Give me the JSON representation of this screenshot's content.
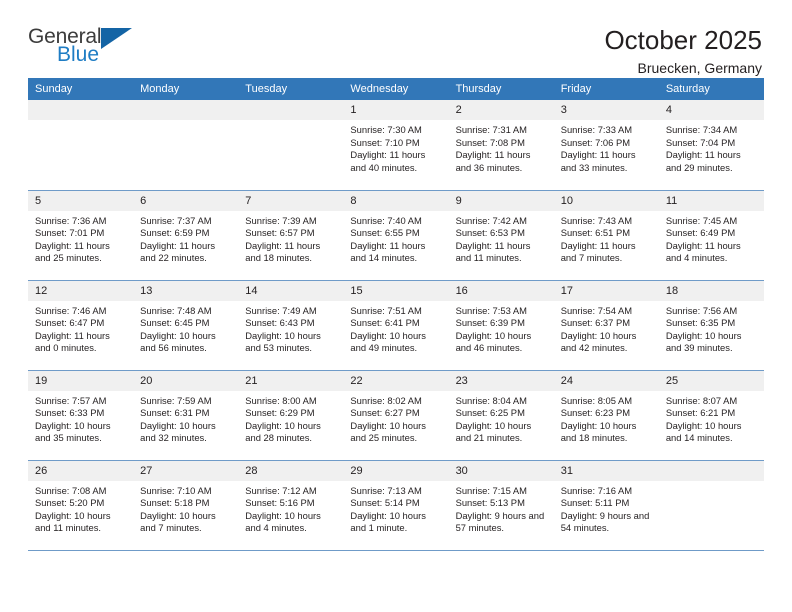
{
  "brand": {
    "name_top": "General",
    "name_bottom": "Blue",
    "triangle_color": "#1464a5",
    "blue_color": "#1f7dc4"
  },
  "header": {
    "title": "October 2025",
    "subtitle": "Bruecken, Germany"
  },
  "theme": {
    "header_bg": "#3277b8",
    "header_text": "#ffffff",
    "daynum_bg": "#f0f0f0",
    "row_border": "#6f9bc8"
  },
  "weekdays": [
    "Sunday",
    "Monday",
    "Tuesday",
    "Wednesday",
    "Thursday",
    "Friday",
    "Saturday"
  ],
  "labels": {
    "sunrise_prefix": "Sunrise: ",
    "sunset_prefix": "Sunset: ",
    "daylight_prefix": "Daylight: "
  },
  "weeks": [
    [
      {
        "day": "",
        "empty": true
      },
      {
        "day": "",
        "empty": true
      },
      {
        "day": "",
        "empty": true
      },
      {
        "day": "1",
        "sunrise": "Sunrise: 7:30 AM",
        "sunset": "Sunset: 7:10 PM",
        "daylight": "Daylight: 11 hours and 40 minutes."
      },
      {
        "day": "2",
        "sunrise": "Sunrise: 7:31 AM",
        "sunset": "Sunset: 7:08 PM",
        "daylight": "Daylight: 11 hours and 36 minutes."
      },
      {
        "day": "3",
        "sunrise": "Sunrise: 7:33 AM",
        "sunset": "Sunset: 7:06 PM",
        "daylight": "Daylight: 11 hours and 33 minutes."
      },
      {
        "day": "4",
        "sunrise": "Sunrise: 7:34 AM",
        "sunset": "Sunset: 7:04 PM",
        "daylight": "Daylight: 11 hours and 29 minutes."
      }
    ],
    [
      {
        "day": "5",
        "sunrise": "Sunrise: 7:36 AM",
        "sunset": "Sunset: 7:01 PM",
        "daylight": "Daylight: 11 hours and 25 minutes."
      },
      {
        "day": "6",
        "sunrise": "Sunrise: 7:37 AM",
        "sunset": "Sunset: 6:59 PM",
        "daylight": "Daylight: 11 hours and 22 minutes."
      },
      {
        "day": "7",
        "sunrise": "Sunrise: 7:39 AM",
        "sunset": "Sunset: 6:57 PM",
        "daylight": "Daylight: 11 hours and 18 minutes."
      },
      {
        "day": "8",
        "sunrise": "Sunrise: 7:40 AM",
        "sunset": "Sunset: 6:55 PM",
        "daylight": "Daylight: 11 hours and 14 minutes."
      },
      {
        "day": "9",
        "sunrise": "Sunrise: 7:42 AM",
        "sunset": "Sunset: 6:53 PM",
        "daylight": "Daylight: 11 hours and 11 minutes."
      },
      {
        "day": "10",
        "sunrise": "Sunrise: 7:43 AM",
        "sunset": "Sunset: 6:51 PM",
        "daylight": "Daylight: 11 hours and 7 minutes."
      },
      {
        "day": "11",
        "sunrise": "Sunrise: 7:45 AM",
        "sunset": "Sunset: 6:49 PM",
        "daylight": "Daylight: 11 hours and 4 minutes."
      }
    ],
    [
      {
        "day": "12",
        "sunrise": "Sunrise: 7:46 AM",
        "sunset": "Sunset: 6:47 PM",
        "daylight": "Daylight: 11 hours and 0 minutes."
      },
      {
        "day": "13",
        "sunrise": "Sunrise: 7:48 AM",
        "sunset": "Sunset: 6:45 PM",
        "daylight": "Daylight: 10 hours and 56 minutes."
      },
      {
        "day": "14",
        "sunrise": "Sunrise: 7:49 AM",
        "sunset": "Sunset: 6:43 PM",
        "daylight": "Daylight: 10 hours and 53 minutes."
      },
      {
        "day": "15",
        "sunrise": "Sunrise: 7:51 AM",
        "sunset": "Sunset: 6:41 PM",
        "daylight": "Daylight: 10 hours and 49 minutes."
      },
      {
        "day": "16",
        "sunrise": "Sunrise: 7:53 AM",
        "sunset": "Sunset: 6:39 PM",
        "daylight": "Daylight: 10 hours and 46 minutes."
      },
      {
        "day": "17",
        "sunrise": "Sunrise: 7:54 AM",
        "sunset": "Sunset: 6:37 PM",
        "daylight": "Daylight: 10 hours and 42 minutes."
      },
      {
        "day": "18",
        "sunrise": "Sunrise: 7:56 AM",
        "sunset": "Sunset: 6:35 PM",
        "daylight": "Daylight: 10 hours and 39 minutes."
      }
    ],
    [
      {
        "day": "19",
        "sunrise": "Sunrise: 7:57 AM",
        "sunset": "Sunset: 6:33 PM",
        "daylight": "Daylight: 10 hours and 35 minutes."
      },
      {
        "day": "20",
        "sunrise": "Sunrise: 7:59 AM",
        "sunset": "Sunset: 6:31 PM",
        "daylight": "Daylight: 10 hours and 32 minutes."
      },
      {
        "day": "21",
        "sunrise": "Sunrise: 8:00 AM",
        "sunset": "Sunset: 6:29 PM",
        "daylight": "Daylight: 10 hours and 28 minutes."
      },
      {
        "day": "22",
        "sunrise": "Sunrise: 8:02 AM",
        "sunset": "Sunset: 6:27 PM",
        "daylight": "Daylight: 10 hours and 25 minutes."
      },
      {
        "day": "23",
        "sunrise": "Sunrise: 8:04 AM",
        "sunset": "Sunset: 6:25 PM",
        "daylight": "Daylight: 10 hours and 21 minutes."
      },
      {
        "day": "24",
        "sunrise": "Sunrise: 8:05 AM",
        "sunset": "Sunset: 6:23 PM",
        "daylight": "Daylight: 10 hours and 18 minutes."
      },
      {
        "day": "25",
        "sunrise": "Sunrise: 8:07 AM",
        "sunset": "Sunset: 6:21 PM",
        "daylight": "Daylight: 10 hours and 14 minutes."
      }
    ],
    [
      {
        "day": "26",
        "sunrise": "Sunrise: 7:08 AM",
        "sunset": "Sunset: 5:20 PM",
        "daylight": "Daylight: 10 hours and 11 minutes."
      },
      {
        "day": "27",
        "sunrise": "Sunrise: 7:10 AM",
        "sunset": "Sunset: 5:18 PM",
        "daylight": "Daylight: 10 hours and 7 minutes."
      },
      {
        "day": "28",
        "sunrise": "Sunrise: 7:12 AM",
        "sunset": "Sunset: 5:16 PM",
        "daylight": "Daylight: 10 hours and 4 minutes."
      },
      {
        "day": "29",
        "sunrise": "Sunrise: 7:13 AM",
        "sunset": "Sunset: 5:14 PM",
        "daylight": "Daylight: 10 hours and 1 minute."
      },
      {
        "day": "30",
        "sunrise": "Sunrise: 7:15 AM",
        "sunset": "Sunset: 5:13 PM",
        "daylight": "Daylight: 9 hours and 57 minutes."
      },
      {
        "day": "31",
        "sunrise": "Sunrise: 7:16 AM",
        "sunset": "Sunset: 5:11 PM",
        "daylight": "Daylight: 9 hours and 54 minutes."
      },
      {
        "day": "",
        "empty": true
      }
    ]
  ]
}
